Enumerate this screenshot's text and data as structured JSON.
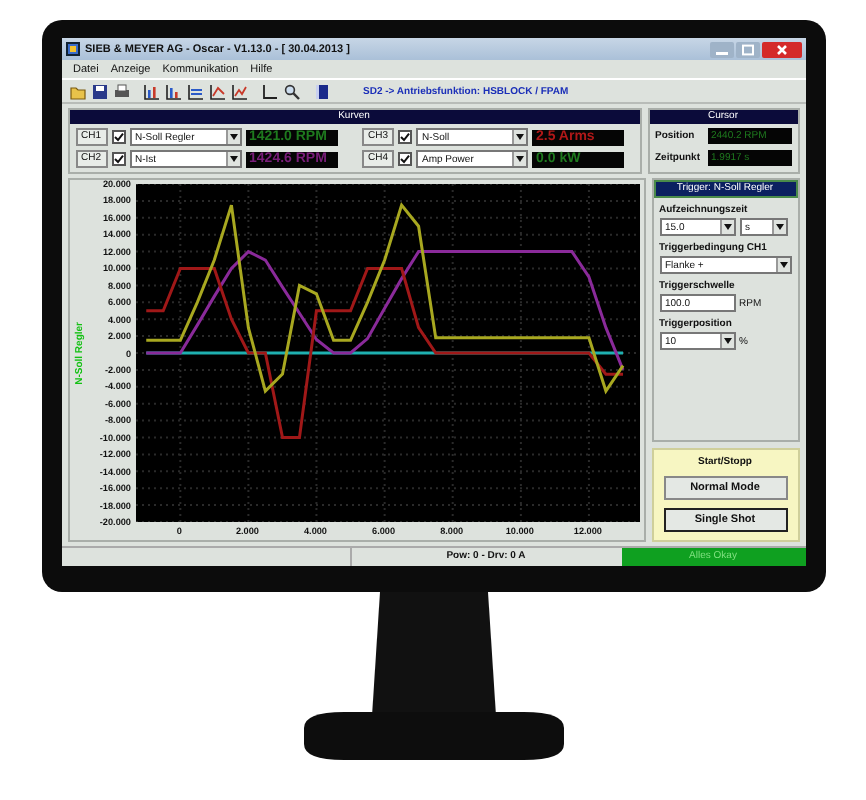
{
  "window": {
    "title": "SIEB & MEYER AG - Oscar - V1.13.0 - [ 30.04.2013 ]"
  },
  "menu": [
    "Datei",
    "Anzeige",
    "Kommunikation",
    "Hilfe"
  ],
  "toolbar": {
    "info": "SD2 -> Antriebsfunktion: HSBLOCK / FPAM"
  },
  "curves": {
    "title": "Kurven",
    "channels": [
      {
        "label": "CH1",
        "checked": true,
        "signal": "N-Soll Regler",
        "reading": "1421.0 RPM",
        "color": "#1e7a1e"
      },
      {
        "label": "CH2",
        "checked": true,
        "signal": "N-Ist",
        "reading": "1424.6 RPM",
        "color": "#7a1e7a"
      },
      {
        "label": "CH3",
        "checked": true,
        "signal": "N-Soll",
        "reading": "2.5 Arms",
        "color": "#b01818"
      },
      {
        "label": "CH4",
        "checked": true,
        "signal": "Amp Power",
        "reading": "0.0 kW",
        "color": "#1e7a1e"
      }
    ]
  },
  "cursor": {
    "title": "Cursor",
    "fields": [
      {
        "label": "Position",
        "value": "2440.2 RPM"
      },
      {
        "label": "Zeitpunkt",
        "value": "1.9917 s"
      }
    ]
  },
  "chart": {
    "chart_data": {
      "type": "line",
      "ylabel": "N-Soll Regler",
      "x": [
        -1,
        -0.5,
        0,
        0.5,
        1,
        1.5,
        2,
        2.5,
        3,
        3.5,
        4,
        4.5,
        5,
        5.5,
        6,
        6.5,
        7,
        7.5,
        8,
        8.5,
        9,
        9.5,
        10,
        10.5,
        11,
        11.5,
        12,
        12.5,
        13
      ],
      "series": [
        {
          "color": "#1fb0b0",
          "values": [
            0,
            0,
            0,
            0,
            0,
            0,
            0,
            0,
            0,
            0,
            0,
            0,
            0,
            0,
            0,
            0,
            0,
            0,
            0,
            0,
            0,
            0,
            0,
            0,
            0,
            0,
            0,
            0,
            0
          ]
        },
        {
          "color": "#8a2a9a",
          "values": [
            0,
            0,
            0,
            3.3,
            6.7,
            10,
            12,
            11,
            7.8,
            4.7,
            1.6,
            0,
            0,
            1.7,
            5.3,
            8.8,
            12,
            12,
            12,
            12,
            12,
            12,
            12,
            12,
            12,
            12,
            9,
            3,
            -2
          ]
        },
        {
          "color": "#a01818",
          "values": [
            5,
            5,
            10,
            10,
            10,
            4,
            0,
            0,
            -10,
            -10,
            5,
            5,
            5,
            10,
            10,
            10,
            3,
            0,
            0,
            0,
            0,
            0,
            0,
            0,
            0,
            0,
            0,
            -2.5,
            -2.5
          ]
        },
        {
          "color": "#a8a820",
          "values": [
            1.5,
            1.5,
            1.5,
            6,
            11,
            17.5,
            3,
            -4.5,
            -2.5,
            8,
            7,
            1.5,
            1.5,
            6,
            11,
            17.5,
            15,
            1.8,
            1.8,
            1.8,
            1.8,
            1.8,
            1.8,
            1.8,
            1.8,
            1.8,
            1.8,
            -4.5,
            -1.5
          ]
        }
      ],
      "xlim": [
        -1.3,
        13.5
      ],
      "ylim": [
        -20,
        20
      ],
      "grid": true,
      "xticks": [
        {
          "value": 0,
          "label": "0"
        },
        {
          "value": 2,
          "label": "2.000"
        },
        {
          "value": 4,
          "label": "4.000"
        },
        {
          "value": 6,
          "label": "6.000"
        },
        {
          "value": 8,
          "label": "8.000"
        },
        {
          "value": 10,
          "label": "10.000"
        },
        {
          "value": 12,
          "label": "12.000"
        }
      ],
      "yticks": [
        {
          "value": 20,
          "label": "20.000"
        },
        {
          "value": 18,
          "label": "18.000"
        },
        {
          "value": 16,
          "label": "16.000"
        },
        {
          "value": 14,
          "label": "14.000"
        },
        {
          "value": 12,
          "label": "12.000"
        },
        {
          "value": 10,
          "label": "10.000"
        },
        {
          "value": 8,
          "label": "8.000"
        },
        {
          "value": 6,
          "label": "6.000"
        },
        {
          "value": 4,
          "label": "4.000"
        },
        {
          "value": 2,
          "label": "2.000"
        },
        {
          "value": 0,
          "label": "0"
        },
        {
          "value": -2,
          "label": "-2.000"
        },
        {
          "value": -4,
          "label": "-4.000"
        },
        {
          "value": -6,
          "label": "-6.000"
        },
        {
          "value": -8,
          "label": "-8.000"
        },
        {
          "value": -10,
          "label": "-10.000"
        },
        {
          "value": -12,
          "label": "-12.000"
        },
        {
          "value": -14,
          "label": "-14.000"
        },
        {
          "value": -16,
          "label": "-16.000"
        },
        {
          "value": -18,
          "label": "-18.000"
        },
        {
          "value": -20,
          "label": "-20.000"
        }
      ]
    }
  },
  "trigger": {
    "title": "Trigger: N-Soll Regler",
    "fields": [
      {
        "label": "Aufzeichnungszeit",
        "kind": "dropdown",
        "value": "15.0",
        "unit": {
          "kind": "dropdown",
          "text": "s"
        }
      },
      {
        "label": "Triggerbedingung CH1",
        "kind": "dropdown",
        "value": "Flanke +"
      },
      {
        "label": "Triggerschwelle",
        "kind": "text",
        "value": "100.0",
        "unit": {
          "kind": "text",
          "text": "RPM"
        }
      },
      {
        "label": "Triggerposition",
        "kind": "dropdown",
        "value": "10",
        "unit": {
          "kind": "text",
          "text": "%"
        }
      }
    ]
  },
  "start_stop": {
    "title": "Start/Stopp",
    "buttons": [
      {
        "label": "Normal Mode",
        "default": false
      },
      {
        "label": "Single Shot",
        "default": true
      }
    ]
  },
  "status_bar": [
    {
      "kind": "plain",
      "text": "Pow: 0 - Drv: 0 A"
    },
    {
      "kind": "ok",
      "text": "Alles Okay"
    }
  ]
}
